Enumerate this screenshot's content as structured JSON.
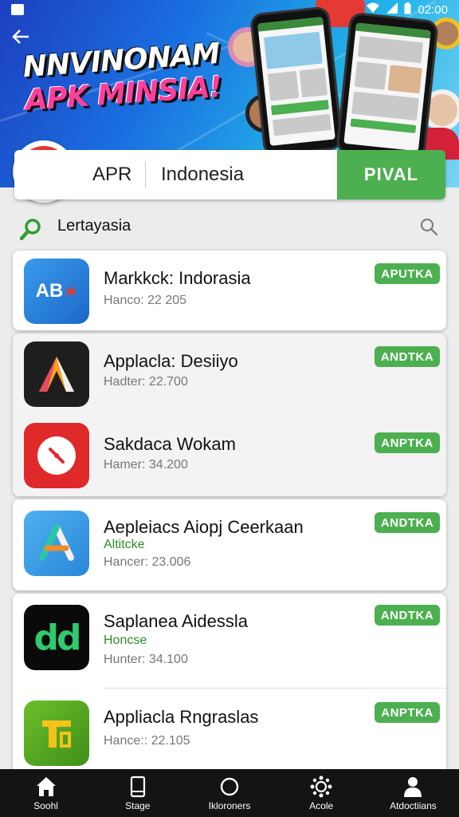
{
  "status_bar": {
    "time": "02:00"
  },
  "banner": {
    "line1": "NNVINONAM",
    "line2": "APK MINSIA!"
  },
  "search": {
    "field1": "APR",
    "field2": "Indonesia",
    "button": "PIVAL"
  },
  "filter": {
    "label": "Lertayasia"
  },
  "apps": [
    {
      "name": "Markkck: Indorasia",
      "sub": "",
      "meta": "Hanco: 22 205",
      "button": "APUTKA",
      "icon": "ab-icon",
      "icon_text": "AB"
    },
    {
      "name": "Applacla: Desiiyo",
      "sub": "",
      "meta": "Hadter: 22.700",
      "button": "ANDTKA",
      "icon": "a-triangle-icon",
      "icon_text": ""
    },
    {
      "name": "Sakdaca Wokam",
      "sub": "",
      "meta": "Hamer: 34.200",
      "button": "ANPTKA",
      "icon": "clock-icon",
      "icon_text": ""
    },
    {
      "name": "Aepleiacs Aiopj Ceerkaan",
      "sub": "Altitcke",
      "meta": "Hancer: 23.006",
      "button": "ANDTKA",
      "icon": "a-pen-icon",
      "icon_text": ""
    },
    {
      "name": "Saplanea Aidessla",
      "sub": "Honcse",
      "meta": "Hunter: 34.100",
      "button": "ANDTKA",
      "icon": "dd-icon",
      "icon_text": "dd"
    },
    {
      "name": "Appliacla Rngraslas",
      "sub": "",
      "meta": "Hance:: 22.105",
      "button": "ANPTKA",
      "icon": "folder-icon",
      "icon_text": ""
    }
  ],
  "bottom_nav": [
    {
      "label": "Soohl",
      "icon": "home-icon"
    },
    {
      "label": "Stage",
      "icon": "tablet-icon"
    },
    {
      "label": "Ikloroners",
      "icon": "circle-icon"
    },
    {
      "label": "Acole",
      "icon": "gear-cluster-icon"
    },
    {
      "label": "Atdoctiians",
      "icon": "person-icon"
    }
  ],
  "colors": {
    "accent_green": "#4caf50",
    "play_red": "#d9241b",
    "nav_bg": "#141414"
  }
}
